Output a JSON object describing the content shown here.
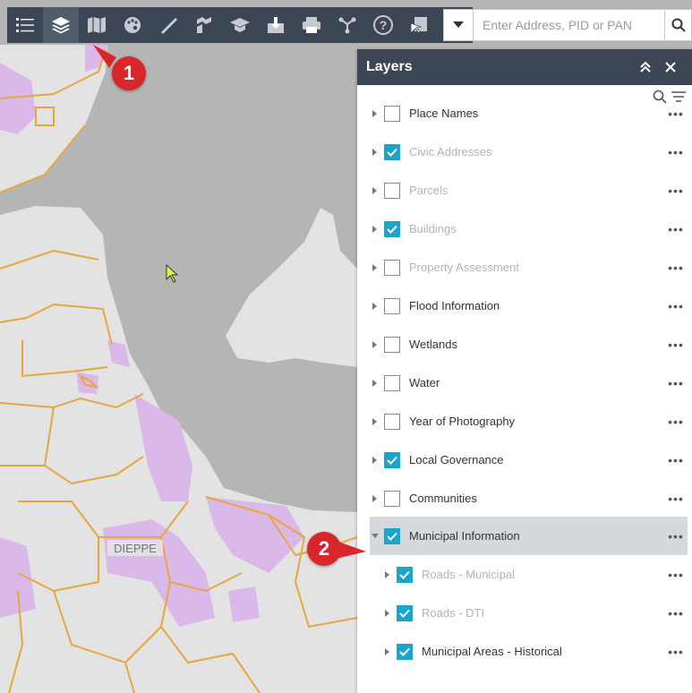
{
  "toolbar": {
    "tools": [
      "legend-icon",
      "layers-icon",
      "basemap-icon",
      "draw-icon",
      "measure-icon",
      "bookmark-icon",
      "education-icon",
      "download-icon",
      "print-icon",
      "share-icon",
      "help-icon",
      "identify-icon"
    ],
    "active": "layers-icon"
  },
  "search": {
    "placeholder": "Enter Address, PID or PAN"
  },
  "panel": {
    "title": "Layers",
    "layers": [
      {
        "label": "Place Names",
        "checked": false,
        "dim": false
      },
      {
        "label": "Civic Addresses",
        "checked": true,
        "dim": true
      },
      {
        "label": "Parcels",
        "checked": false,
        "dim": true
      },
      {
        "label": "Buildings",
        "checked": true,
        "dim": true
      },
      {
        "label": "Property Assessment",
        "checked": false,
        "dim": true
      },
      {
        "label": "Flood Information",
        "checked": false,
        "dim": false
      },
      {
        "label": "Wetlands",
        "checked": false,
        "dim": false
      },
      {
        "label": "Water",
        "checked": false,
        "dim": false
      },
      {
        "label": "Year of Photography",
        "checked": false,
        "dim": false
      },
      {
        "label": "Local Governance",
        "checked": true,
        "dim": false
      },
      {
        "label": "Communities",
        "checked": false,
        "dim": false
      },
      {
        "label": "Municipal Information",
        "checked": true,
        "dim": false,
        "expanded": true,
        "selected": true
      },
      {
        "label": "Roads - Municipal",
        "checked": true,
        "dim": true,
        "child": true
      },
      {
        "label": "Roads - DTI",
        "checked": true,
        "dim": true,
        "child": true
      },
      {
        "label": "Municipal Areas - Historical",
        "checked": true,
        "dim": false,
        "child": true
      }
    ],
    "more_label": "•••"
  },
  "map": {
    "place_label": "DIEPPE"
  },
  "callouts": [
    "1",
    "2"
  ],
  "colors": {
    "toolbar": "#3d4654",
    "check": "#1aa5cc",
    "callout": "#d9262a",
    "boundary": "#e8a640",
    "zone": "#d9b3e8",
    "water": "#a8a8a8",
    "land": "#e6e6e6"
  }
}
